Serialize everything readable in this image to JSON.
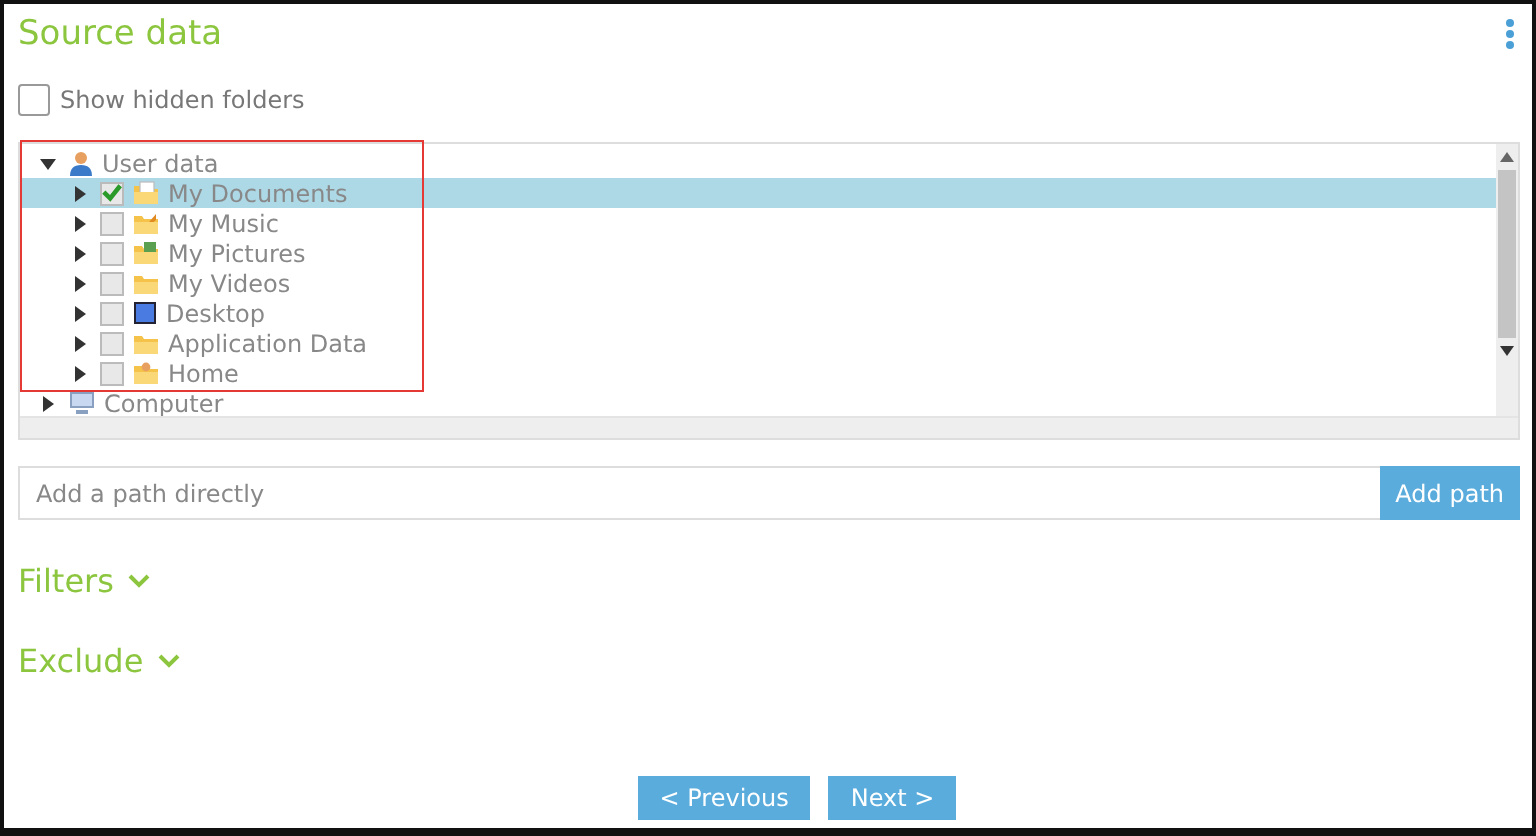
{
  "header": {
    "title": "Source data"
  },
  "show_hidden": {
    "label": "Show hidden folders",
    "checked": false
  },
  "tree": [
    {
      "label": "User data",
      "kind": "user",
      "expanded": true,
      "selected": false,
      "children": [
        {
          "label": "My Documents",
          "kind": "documents",
          "checked": true,
          "expanded": false,
          "selected": true
        },
        {
          "label": "My Music",
          "kind": "music",
          "checked": false,
          "expanded": false,
          "selected": false
        },
        {
          "label": "My Pictures",
          "kind": "pictures",
          "checked": false,
          "expanded": false,
          "selected": false
        },
        {
          "label": "My Videos",
          "kind": "folder",
          "checked": false,
          "expanded": false,
          "selected": false
        },
        {
          "label": "Desktop",
          "kind": "desktop",
          "checked": false,
          "expanded": false,
          "selected": false
        },
        {
          "label": "Application Data",
          "kind": "folder",
          "checked": false,
          "expanded": false,
          "selected": false
        },
        {
          "label": "Home",
          "kind": "home",
          "checked": false,
          "expanded": false,
          "selected": false
        }
      ]
    },
    {
      "label": "Computer",
      "kind": "computer",
      "expanded": false,
      "selected": false
    }
  ],
  "path": {
    "placeholder": "Add a path directly",
    "button": "Add path"
  },
  "sections": [
    {
      "label": "Filters"
    },
    {
      "label": "Exclude"
    }
  ],
  "buttons": [
    "< Previous",
    "Next >"
  ]
}
